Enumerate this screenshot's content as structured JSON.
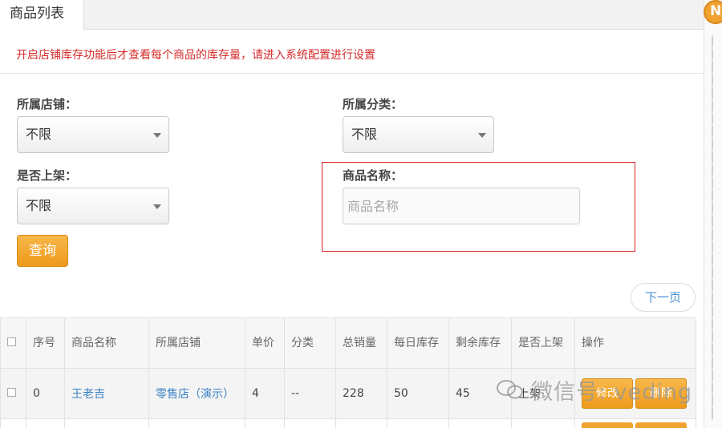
{
  "tab": {
    "label": "商品列表"
  },
  "notice": "开启店铺库存功能后才查看每个商品的库存量，请进入系统配置进行设置",
  "filters": {
    "store": {
      "label": "所属店铺：",
      "value": "不限"
    },
    "category": {
      "label": "所属分类：",
      "value": "不限"
    },
    "on_shelf": {
      "label": "是否上架：",
      "value": "不限"
    },
    "product_name": {
      "label": "商品名称：",
      "placeholder": "商品名称",
      "value": ""
    }
  },
  "query_button": "查询",
  "next_page": "下一页",
  "table": {
    "headers": [
      "序号",
      "商品名称",
      "所属店铺",
      "单价",
      "分类",
      "总销量",
      "每日库存",
      "剩余库存",
      "是否上架",
      "操作"
    ],
    "rows": [
      {
        "index": "0",
        "name": "王老吉",
        "store": "零售店（演示）",
        "price": "4",
        "category": "--",
        "total_sales": "228",
        "daily_stock": "50",
        "remaining_stock": "45",
        "on_shelf": "上架",
        "actions": [
          "修改",
          "删除"
        ]
      }
    ]
  },
  "watermark": "微信号: veding",
  "colors": {
    "accent": "#f0a22f",
    "notice_red": "#d62b2b",
    "link_blue": "#3b82c4",
    "highlight_box": "#dd2222"
  }
}
